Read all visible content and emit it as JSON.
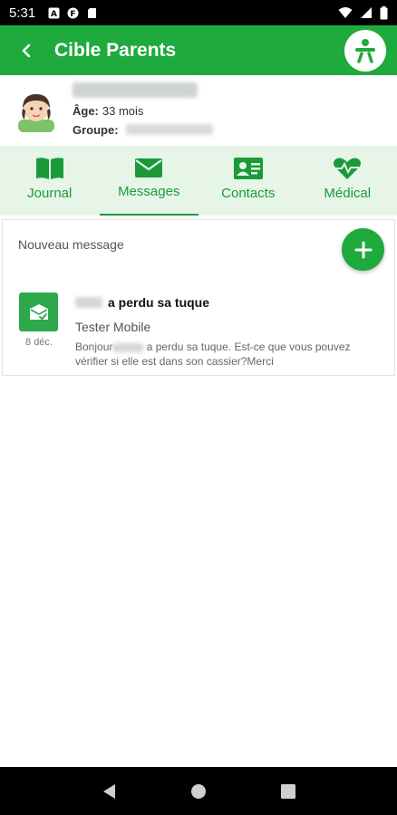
{
  "status_bar": {
    "time": "5:31"
  },
  "app_bar": {
    "title": "Cible Parents"
  },
  "child": {
    "age_label": "Âge:",
    "age_value": "33 mois",
    "group_label": "Groupe:"
  },
  "tabs": [
    {
      "label": "Journal",
      "icon": "book-icon"
    },
    {
      "label": "Messages",
      "icon": "envelope-icon",
      "active": true
    },
    {
      "label": "Contacts",
      "icon": "contact-card-icon"
    },
    {
      "label": "Médical",
      "icon": "heartbeat-icon"
    }
  ],
  "messages": {
    "new_message_label": "Nouveau message",
    "items": [
      {
        "subject": "a perdu sa tuque",
        "sender": "Tester Mobile",
        "date": "8 déc.",
        "preview_prefix": "Bonjour",
        "preview_suffix": " a perdu sa tuque. Est-ce que vous pouvez vérifier si elle est dans son cassier?Merci"
      }
    ]
  },
  "colors": {
    "primary": "#1faa3e",
    "tab_background": "#e6f5e8"
  }
}
